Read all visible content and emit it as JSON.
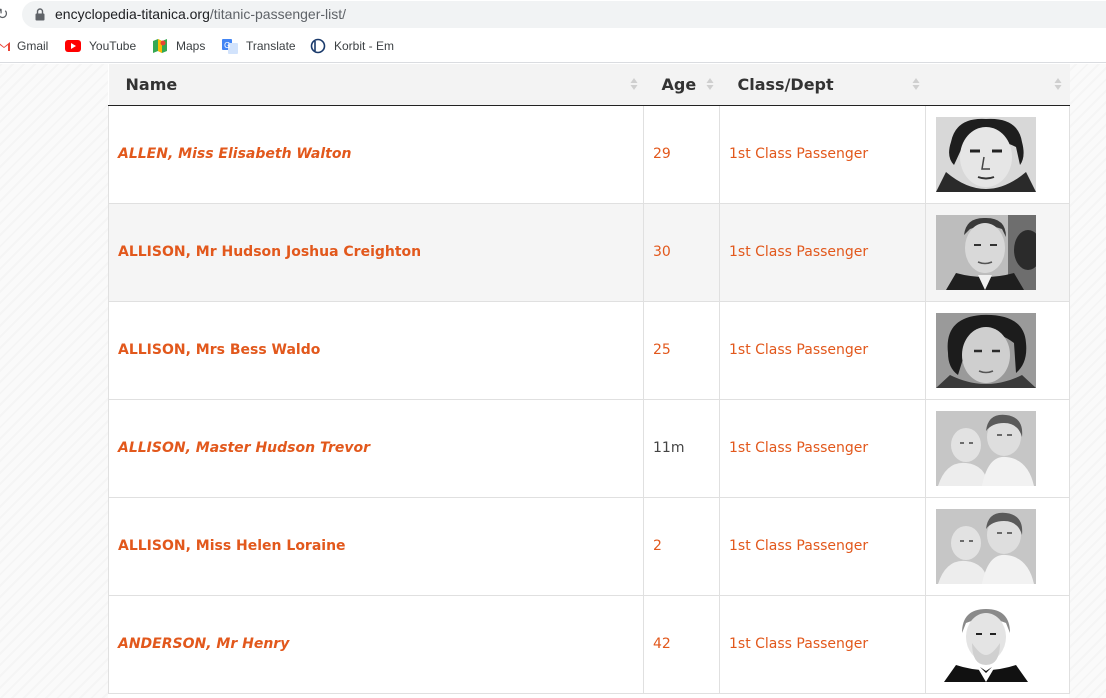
{
  "browser": {
    "url_domain": "encyclopedia-titanica.org",
    "url_path": "/titanic-passenger-list/"
  },
  "bookmarks": [
    {
      "label": "Gmail",
      "icon": "gmail-icon"
    },
    {
      "label": "YouTube",
      "icon": "youtube-icon"
    },
    {
      "label": "Maps",
      "icon": "maps-icon"
    },
    {
      "label": "Translate",
      "icon": "translate-icon"
    },
    {
      "label": "Korbit - Em",
      "icon": "korbit-icon"
    }
  ],
  "table": {
    "headers": {
      "name": "Name",
      "age": "Age",
      "class": "Class/Dept",
      "photo": ""
    },
    "rows": [
      {
        "name": "ALLEN, Miss Elisabeth Walton",
        "age": "29",
        "class": "1st Class Passenger",
        "italic": true,
        "age_linked": true
      },
      {
        "name": "ALLISON, Mr Hudson Joshua Creighton",
        "age": "30",
        "class": "1st Class Passenger",
        "italic": false,
        "age_linked": true
      },
      {
        "name": "ALLISON, Mrs Bess Waldo",
        "age": "25",
        "class": "1st Class Passenger",
        "italic": false,
        "age_linked": true
      },
      {
        "name": "ALLISON, Master Hudson Trevor",
        "age": "11m",
        "class": "1st Class Passenger",
        "italic": true,
        "age_linked": false
      },
      {
        "name": "ALLISON, Miss Helen Loraine",
        "age": "2",
        "class": "1st Class Passenger",
        "italic": false,
        "age_linked": true
      },
      {
        "name": "ANDERSON, Mr Henry",
        "age": "42",
        "class": "1st Class Passenger",
        "italic": true,
        "age_linked": true
      }
    ]
  },
  "colors": {
    "link": "#e2581c",
    "header_bg": "#f3f3f3",
    "row_alt_bg": "#f5f5f5"
  }
}
